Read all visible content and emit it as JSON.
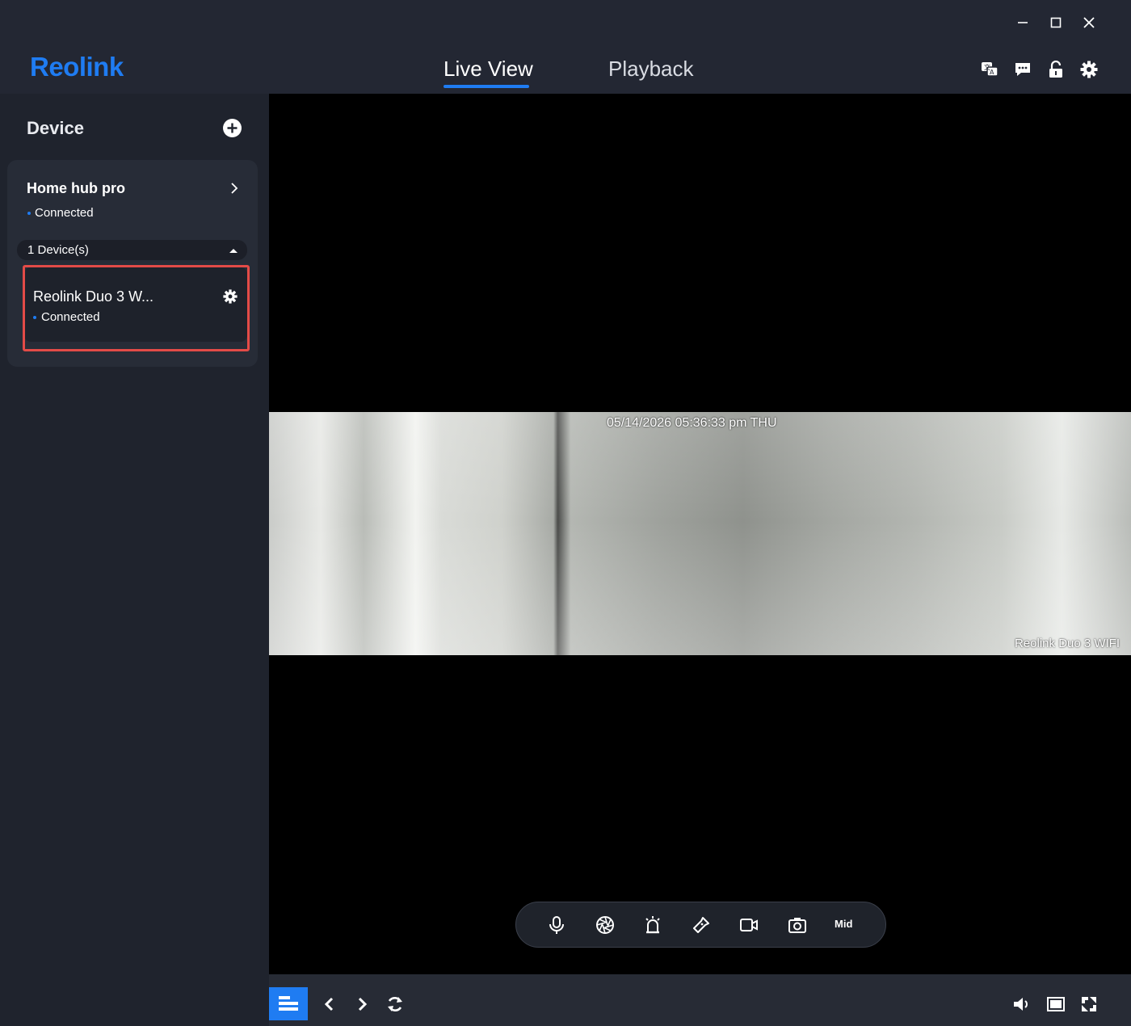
{
  "app": {
    "logo": "Reolink"
  },
  "window_controls": [
    "minimize-icon",
    "maximize-icon",
    "close-icon"
  ],
  "tabs": [
    {
      "label": "Live View",
      "active": true
    },
    {
      "label": "Playback",
      "active": false
    }
  ],
  "header_icons": [
    "translate-icon",
    "message-icon",
    "unlock-icon",
    "gear-icon"
  ],
  "sidebar": {
    "heading": "Device",
    "hub": {
      "name": "Home hub pro",
      "status": "Connected",
      "device_count": "1 Device(s)",
      "cameras": [
        {
          "name": "Reolink Duo 3 W...",
          "status": "Connected"
        }
      ]
    }
  },
  "video": {
    "timestamp": "05/14/2026 05:36:33 pm THU",
    "camera_label": "Reolink Duo 3 WIFI"
  },
  "controls": {
    "icons": [
      "microphone-icon",
      "aperture-icon",
      "siren-icon",
      "flashlight-icon",
      "record-icon",
      "snapshot-icon"
    ],
    "quality": "Mid"
  },
  "bottom_bar": {
    "left_icons": [
      "layout-icon",
      "previous-icon",
      "next-icon",
      "refresh-icon"
    ],
    "right_icons": [
      "volume-icon",
      "screen-ratio-icon",
      "fullscreen-icon"
    ]
  },
  "colors": {
    "accent": "#1f7cf2",
    "highlight": "#e34b47",
    "panel": "#272c37"
  }
}
